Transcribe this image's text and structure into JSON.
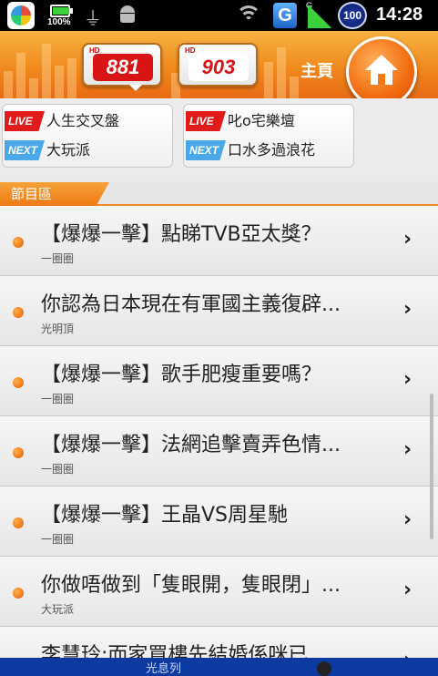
{
  "status_bar": {
    "battery_text": "100%",
    "battery_level": 1.0,
    "level_badge": "100",
    "time": "14:28",
    "signal_type": "G",
    "icons": [
      "app-launcher-icon",
      "battery-icon",
      "usb-icon",
      "android-icon",
      "wifi-icon",
      "g-icon",
      "signal-icon",
      "level-icon"
    ]
  },
  "header": {
    "stations": [
      {
        "hd": "HD",
        "logo": "881"
      },
      {
        "hd": "HD",
        "logo": "903"
      }
    ],
    "home_label": "主頁"
  },
  "now_playing": [
    {
      "live_tag": "LIVE",
      "live_title": "人生交叉盤",
      "next_tag": "NEXT",
      "next_title": "大玩派"
    },
    {
      "live_tag": "LIVE",
      "live_title": "叱o宅樂壇",
      "next_tag": "NEXT",
      "next_title": "口水多過浪花"
    }
  ],
  "section_title": "節目區",
  "programs": [
    {
      "title": "【爆爆一擊】點睇TVB亞太獎？",
      "host": "一圈圈"
    },
    {
      "title": "你認為日本現在有軍國主義復辟...",
      "host": "光明頂"
    },
    {
      "title": "【爆爆一擊】歌手肥瘦重要嗎？",
      "host": "一圈圈"
    },
    {
      "title": "【爆爆一擊】法網追擊賣弄色情...",
      "host": "一圈圈"
    },
    {
      "title": "【爆爆一擊】王晶VS周星馳",
      "host": "一圈圈"
    },
    {
      "title": "你做唔做到「隻眼開，隻眼閉」...",
      "host": "大玩派"
    },
    {
      "title": "李慧玲:而家買樓先結婚係咪已...",
      "host": ""
    }
  ],
  "bottom_bar": {
    "label": "光息列"
  },
  "colors": {
    "accent": "#f08a1e",
    "live": "#e01b1b",
    "next": "#4aa8e8",
    "bottom": "#0b3aa0"
  }
}
